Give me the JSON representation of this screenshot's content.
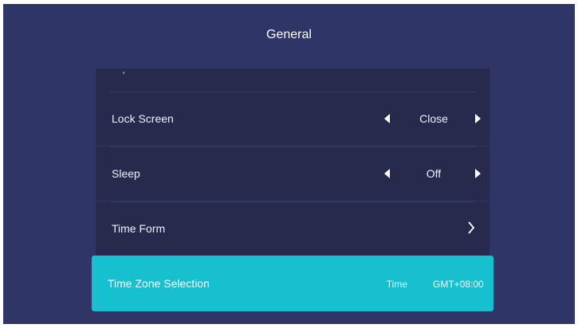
{
  "header": {
    "title": "General"
  },
  "items": [
    {
      "label": "Lock Screen",
      "value": "Close"
    },
    {
      "label": "Sleep",
      "value": "Off"
    },
    {
      "label": "Time Form"
    }
  ],
  "partial_item": {
    "text": "'"
  },
  "selected_item": {
    "label": "Time Zone Selection",
    "subtitle": "Time",
    "value": "GMT+08:00"
  },
  "icons": {
    "left_arrow": "triangle-left-icon",
    "right_arrow": "triangle-right-icon",
    "chevron": "chevron-right-icon"
  },
  "colors": {
    "background": "#2f3566",
    "row": "#262b4e",
    "selected": "#16c0cf",
    "text": "#ffffff"
  }
}
